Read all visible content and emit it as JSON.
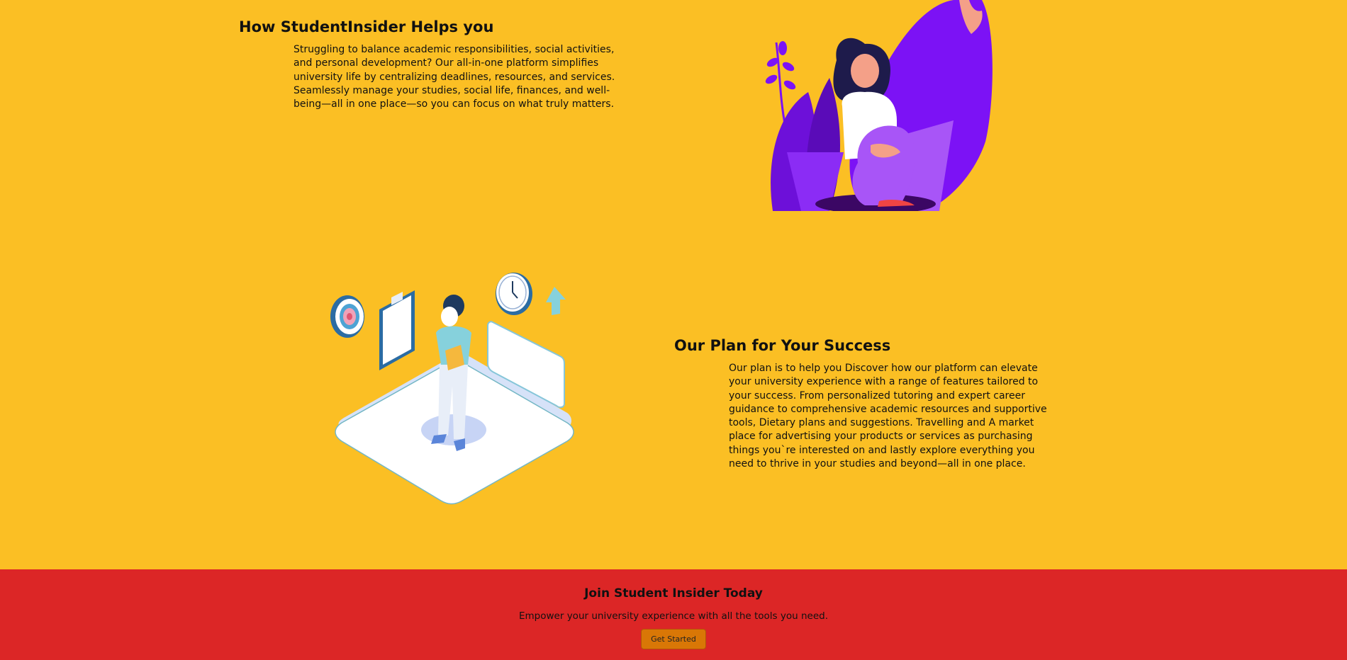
{
  "help_section": {
    "title": "How StudentInsider Helps you",
    "description": "Struggling to balance academic responsibilities, social activities, and personal development? Our all-in-one platform simplifies university life by centralizing deadlines, resources, and services. Seamlessly manage your studies, social life, finances, and well-being—all in one place—so you can focus on what truly matters."
  },
  "plan_section": {
    "title": "Our Plan for Your Success",
    "description": "Our plan is to help you Discover how our platform can elevate your university experience with a range of features tailored to your success. From personalized tutoring and expert career guidance to comprehensive academic resources and supportive tools, Dietary plans and suggestions. Travelling and A market place for advertising your products or services as purchasing things you`re interested on and lastly explore everything you need to thrive in your studies and beyond—all in one place."
  },
  "cta_section": {
    "title": "Join Student Insider Today",
    "subtitle": "Empower your university experience with all the tools you need.",
    "button_label": "Get Started"
  },
  "colors": {
    "page_background": "#fbbf24",
    "cta_background": "#dc2626",
    "button_background": "#d97706",
    "illustration_accent": "#7c12f5"
  }
}
